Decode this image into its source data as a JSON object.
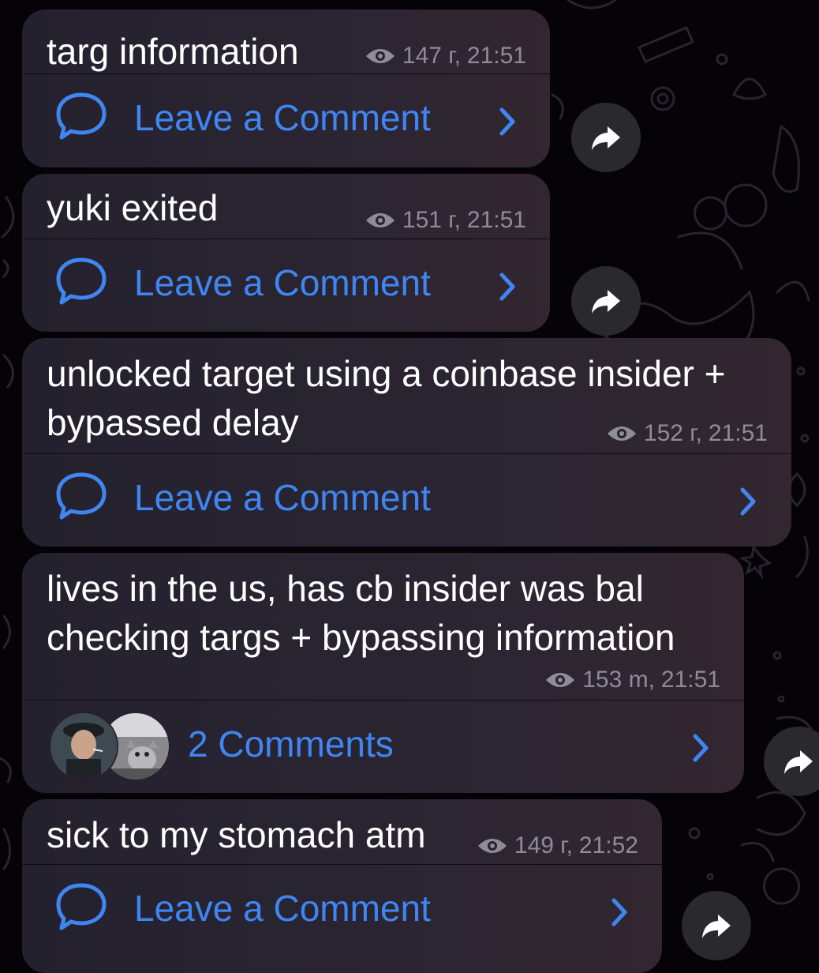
{
  "colors": {
    "bubble": "#2a2432",
    "link": "#3f86f3",
    "meta": "#8f8c99",
    "text": "#ffffff"
  },
  "messages": [
    {
      "text": "targ information",
      "views": "147 г,",
      "time": "21:51",
      "action": "Leave a Comment",
      "icon": "comment-bubble-icon"
    },
    {
      "text": "yuki exited",
      "views": "151 г,",
      "time": "21:51",
      "action": "Leave a Comment",
      "icon": "comment-bubble-icon"
    },
    {
      "text": "unlocked target using a coinbase insider +\nbypassed delay",
      "views": "152 г,",
      "time": "21:51",
      "action": "Leave a Comment",
      "icon": "comment-bubble-icon"
    },
    {
      "text": "lives in the us, has cb insider was bal\nchecking targs + bypassing information",
      "views": "153 m,",
      "time": "21:51",
      "action": "2 Comments",
      "icon": "commenter-avatars"
    },
    {
      "text": "sick to my stomach atm",
      "views": "149 г,",
      "time": "21:52",
      "action": "Leave a Comment",
      "icon": "comment-bubble-icon"
    }
  ]
}
